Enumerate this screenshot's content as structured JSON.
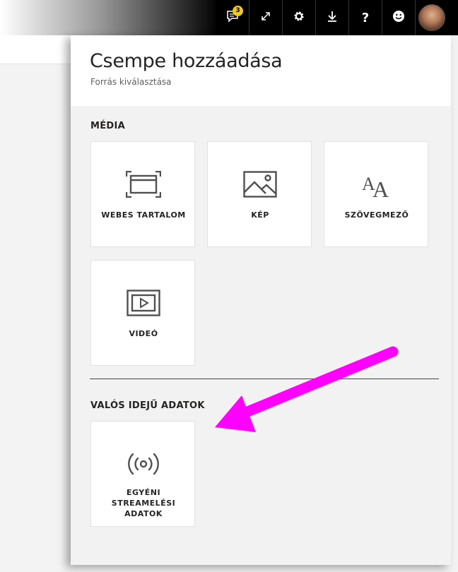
{
  "topbar": {
    "notification_count": "3",
    "help_label": "?"
  },
  "panel": {
    "title": "Csempe hozzáadása",
    "subtitle": "Forrás kiválasztása"
  },
  "sections": {
    "media": {
      "title": "MÉDIA",
      "tiles": {
        "web": "WEBES TARTALOM",
        "image": "KÉP",
        "text": "SZÖVEGMEZŐ",
        "video": "VIDEÓ"
      }
    },
    "realtime": {
      "title": "VALÓS IDEJŰ ADATOK",
      "tiles": {
        "streaming": "EGYÉNI STREAMELÉSI ADATOK"
      }
    }
  },
  "colors": {
    "badge": "#f2c811",
    "arrow": "#ff00ff",
    "icon": "#505050"
  }
}
